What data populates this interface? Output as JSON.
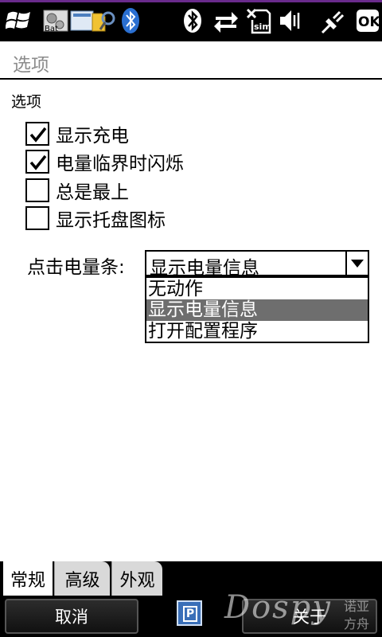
{
  "status_bar": {
    "icons": [
      "windows-start-icon",
      "app-launcher-icon",
      "bluetooth-app-icon",
      "bluetooth-icon",
      "sync-icon",
      "no-sim-icon",
      "volume-muted-icon",
      "charging-plug-icon",
      "ok-button"
    ],
    "ok_label": "OK"
  },
  "title": "选项",
  "section": "选项",
  "options": [
    {
      "label": "显示充电",
      "checked": true
    },
    {
      "label": "电量临界时闪烁",
      "checked": true
    },
    {
      "label": "总是最上",
      "checked": false
    },
    {
      "label": "显示托盘图标",
      "checked": false
    }
  ],
  "click_bar": {
    "label": "点击电量条:",
    "value": "显示电量信息",
    "dropdown": [
      "无动作",
      "显示电量信息",
      "打开配置程序"
    ],
    "selected_index": 1
  },
  "tabs": [
    {
      "label": "常规",
      "active": true
    },
    {
      "label": "高级",
      "active": false
    },
    {
      "label": "外观",
      "active": false
    }
  ],
  "softkeys": {
    "left": "取消",
    "right": "关于"
  },
  "input_panel_label": "P",
  "watermark": {
    "text": "Dospy",
    "cn_top": "诺亚",
    "cn_bottom": "方舟"
  }
}
